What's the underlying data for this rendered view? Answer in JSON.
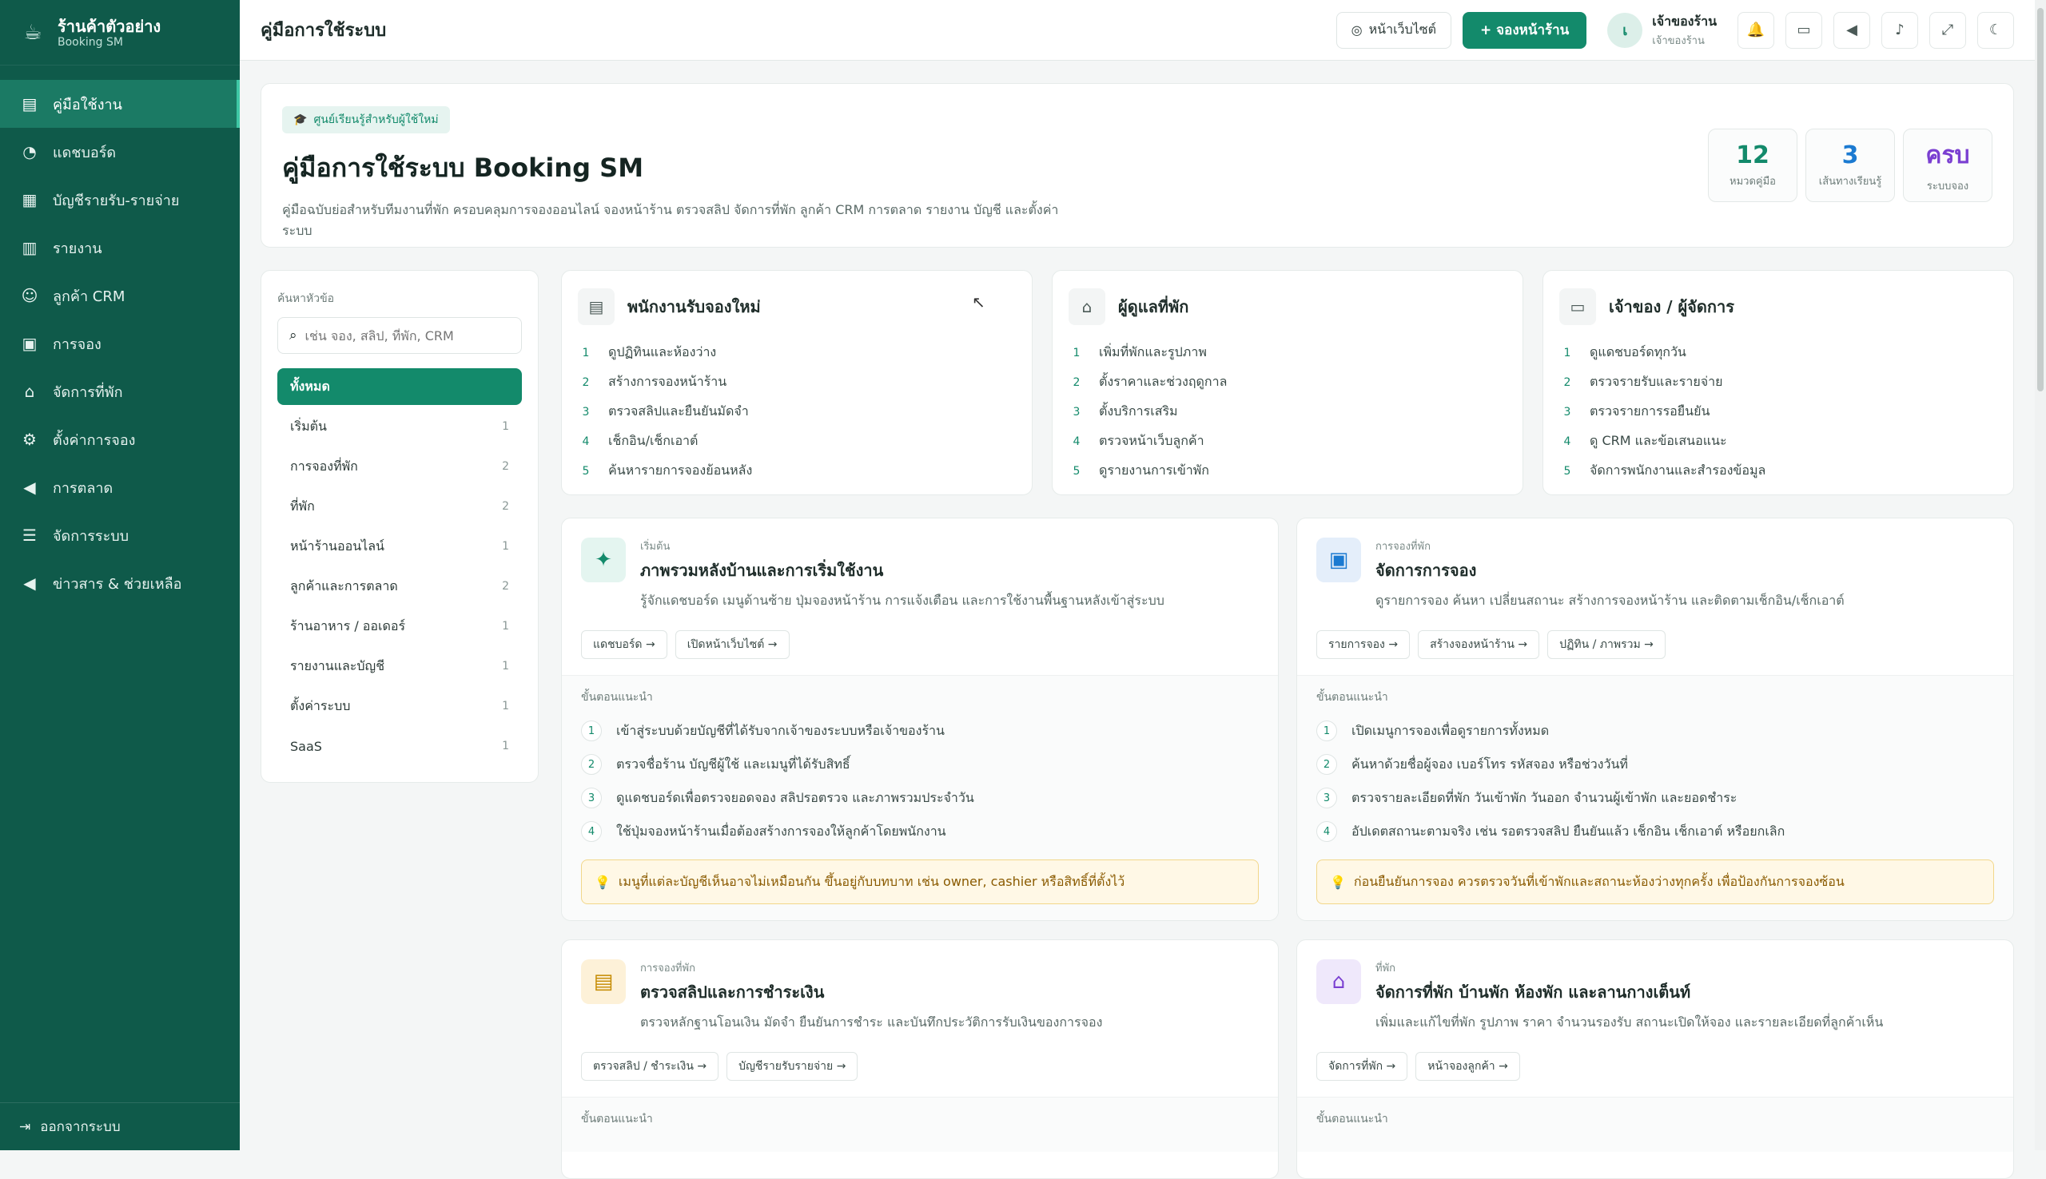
{
  "brand": {
    "name": "ร้านค้าตัวอย่าง",
    "sub": "Booking SM",
    "logo_icon": "coffee-cup-icon"
  },
  "sidebar": {
    "items": [
      {
        "label": "คู่มือใช้งาน",
        "icon": "book-icon",
        "glyph": "▤",
        "active": true
      },
      {
        "label": "แดชบอร์ด",
        "icon": "dashboard-icon",
        "glyph": "◔",
        "active": false
      },
      {
        "label": "บัญชีรายรับ-รายจ่าย",
        "icon": "ledger-icon",
        "glyph": "▦",
        "active": false
      },
      {
        "label": "รายงาน",
        "icon": "report-icon",
        "glyph": "▥",
        "active": false
      },
      {
        "label": "ลูกค้า CRM",
        "icon": "users-icon",
        "glyph": "☺",
        "active": false
      },
      {
        "label": "การจอง",
        "icon": "calendar-icon",
        "glyph": "▣",
        "active": false
      },
      {
        "label": "จัดการที่พัก",
        "icon": "home-icon",
        "glyph": "⌂",
        "active": false
      },
      {
        "label": "ตั้งค่าการจอง",
        "icon": "gear-icon",
        "glyph": "⚙",
        "active": false
      },
      {
        "label": "การตลาด",
        "icon": "megaphone-icon",
        "glyph": "◀",
        "active": false
      },
      {
        "label": "จัดการระบบ",
        "icon": "sliders-icon",
        "glyph": "☰",
        "active": false
      },
      {
        "label": "ข่าวสาร & ช่วยเหลือ",
        "icon": "news-icon",
        "glyph": "◀",
        "active": false
      }
    ],
    "logout": "ออกจากระบบ"
  },
  "topbar": {
    "title": "คู่มือการใช้ระบบ",
    "website_button": "หน้าเว็บไซต์",
    "book_button": "+ จองหน้าร้าน",
    "user": {
      "initial": "เ",
      "name": "เจ้าของร้าน",
      "role": "เจ้าของร้าน"
    }
  },
  "hero": {
    "badge": "ศูนย์เรียนรู้สำหรับผู้ใช้ใหม่",
    "title": "คู่มือการใช้ระบบ Booking SM",
    "desc": "คู่มือฉบับย่อสำหรับทีมงานที่พัก ครอบคลุมการจองออนไลน์ จองหน้าร้าน ตรวจสลิป จัดการที่พัก ลูกค้า CRM การตลาด รายงาน บัญชี และตั้งค่าระบบ",
    "stats": [
      {
        "value": "12",
        "label": "หมวดคู่มือ",
        "color": "#138a6b"
      },
      {
        "value": "3",
        "label": "เส้นทางเรียนรู้",
        "color": "#1b7ad1"
      },
      {
        "value": "ครบ",
        "label": "ระบบจอง",
        "color": "#7a3fd1"
      }
    ]
  },
  "search": {
    "label": "ค้นหาหัวข้อ",
    "placeholder": "เช่น จอง, สลิป, ที่พัก, CRM",
    "topics": [
      {
        "label": "ทั้งหมด",
        "count": "",
        "active": true
      },
      {
        "label": "เริ่มต้น",
        "count": "1",
        "active": false
      },
      {
        "label": "การจองที่พัก",
        "count": "2",
        "active": false
      },
      {
        "label": "ที่พัก",
        "count": "2",
        "active": false
      },
      {
        "label": "หน้าร้านออนไลน์",
        "count": "1",
        "active": false
      },
      {
        "label": "ลูกค้าและการตลาด",
        "count": "2",
        "active": false
      },
      {
        "label": "ร้านอาหาร / ออเดอร์",
        "count": "1",
        "active": false
      },
      {
        "label": "รายงานและบัญชี",
        "count": "1",
        "active": false
      },
      {
        "label": "ตั้งค่าระบบ",
        "count": "1",
        "active": false
      },
      {
        "label": "SaaS",
        "count": "1",
        "active": false
      }
    ]
  },
  "roles": [
    {
      "title": "พนักงานรับจองใหม่",
      "icon": "id-card-icon",
      "glyph": "▤",
      "items": [
        "ดูปฏิทินและห้องว่าง",
        "สร้างการจองหน้าร้าน",
        "ตรวจสลิปและยืนยันมัดจำ",
        "เช็กอิน/เช็กเอาต์",
        "ค้นหารายการจองย้อนหลัง"
      ]
    },
    {
      "title": "ผู้ดูแลที่พัก",
      "icon": "house-icon",
      "glyph": "⌂",
      "items": [
        "เพิ่มที่พักและรูปภาพ",
        "ตั้งราคาและช่วงฤดูกาล",
        "ตั้งบริการเสริม",
        "ตรวจหน้าเว็บลูกค้า",
        "ดูรายงานการเข้าพัก"
      ]
    },
    {
      "title": "เจ้าของ / ผู้จัดการ",
      "icon": "briefcase-icon",
      "glyph": "▭",
      "items": [
        "ดูแดชบอร์ดทุกวัน",
        "ตรวจรายรับและรายจ่าย",
        "ตรวจรายการรอยืนยัน",
        "ดู CRM และข้อเสนอแนะ",
        "จัดการพนักงานและสำรองข้อมูล"
      ]
    }
  ],
  "guides": [
    {
      "category": "เริ่มต้น",
      "title": "ภาพรวมหลังบ้านและการเริ่มใช้งาน",
      "icon": "compass-icon",
      "glyph": "✦",
      "desc": "รู้จักแดชบอร์ด เมนูด้านซ้าย ปุ่มจองหน้าร้าน การแจ้งเตือน และการใช้งานพื้นฐานหลังเข้าสู่ระบบ",
      "chips": [
        "แดชบอร์ด →",
        "เปิดหน้าเว็บไซต์ →"
      ],
      "steps_label": "ขั้นตอนแนะนำ",
      "steps": [
        "เข้าสู่ระบบด้วยบัญชีที่ได้รับจากเจ้าของระบบหรือเจ้าของร้าน",
        "ตรวจชื่อร้าน บัญชีผู้ใช้ และเมนูที่ได้รับสิทธิ์",
        "ดูแดชบอร์ดเพื่อตรวจยอดจอง สลิปรอตรวจ และภาพรวมประจำวัน",
        "ใช้ปุ่มจองหน้าร้านเมื่อต้องสร้างการจองให้ลูกค้าโดยพนักงาน"
      ],
      "tip": "เมนูที่แต่ละบัญชีเห็นอาจไม่เหมือนกัน ขึ้นอยู่กับบทบาท เช่น owner, cashier หรือสิทธิ์ที่ตั้งไว้"
    },
    {
      "category": "การจองที่พัก",
      "title": "จัดการการจอง",
      "icon": "calendar-check-icon",
      "glyph": "▣",
      "desc": "ดูรายการจอง ค้นหา เปลี่ยนสถานะ สร้างการจองหน้าร้าน และติดตามเช็กอิน/เช็กเอาต์",
      "chips": [
        "รายการจอง →",
        "สร้างจองหน้าร้าน →",
        "ปฏิทิน / ภาพรวม →"
      ],
      "steps_label": "ขั้นตอนแนะนำ",
      "steps": [
        "เปิดเมนูการจองเพื่อดูรายการทั้งหมด",
        "ค้นหาด้วยชื่อผู้จอง เบอร์โทร รหัสจอง หรือช่วงวันที่",
        "ตรวจรายละเอียดที่พัก วันเข้าพัก วันออก จำนวนผู้เข้าพัก และยอดชำระ",
        "อัปเดตสถานะตามจริง เช่น รอตรวจสลิป ยืนยันแล้ว เช็กอิน เช็กเอาต์ หรือยกเลิก"
      ],
      "tip": "ก่อนยืนยันการจอง ควรตรวจวันที่เข้าพักและสถานะห้องว่างทุกครั้ง เพื่อป้องกันการจองซ้อน"
    },
    {
      "category": "การจองที่พัก",
      "title": "ตรวจสลิปและการชำระเงิน",
      "icon": "receipt-icon",
      "glyph": "▤",
      "desc": "ตรวจหลักฐานโอนเงิน มัดจำ ยืนยันการชำระ และบันทึกประวัติการรับเงินของการจอง",
      "chips": [
        "ตรวจสลิป / ชำระเงิน →",
        "บัญชีรายรับรายจ่าย →"
      ],
      "steps_label": "ขั้นตอนแนะนำ",
      "steps": [],
      "tip": ""
    },
    {
      "category": "ที่พัก",
      "title": "จัดการที่พัก บ้านพัก ห้องพัก และลานกางเต็นท์",
      "icon": "house-icon",
      "glyph": "⌂",
      "desc": "เพิ่มและแก้ไขที่พัก รูปภาพ ราคา จำนวนรองรับ สถานะเปิดให้จอง และรายละเอียดที่ลูกค้าเห็น",
      "chips": [
        "จัดการที่พัก →",
        "หน้าจองลูกค้า →"
      ],
      "steps_label": "ขั้นตอนแนะนำ",
      "steps": [],
      "tip": ""
    }
  ],
  "colors": {
    "sidebar": "#0f5a4a",
    "accent": "#138a6b",
    "tip_bg": "#fff8e6"
  }
}
